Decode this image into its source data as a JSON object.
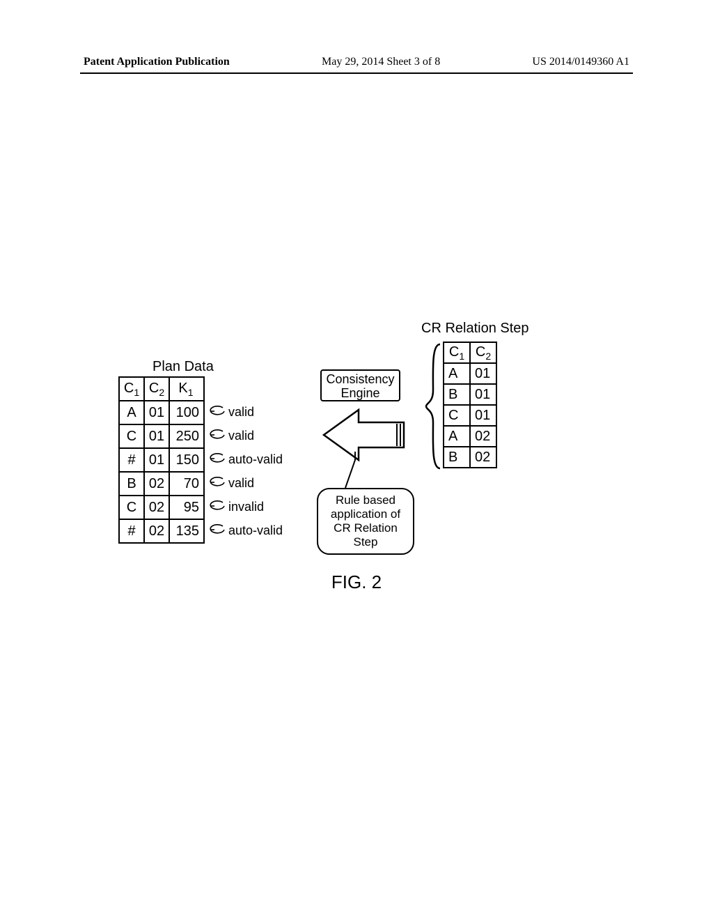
{
  "header": {
    "left": "Patent Application Publication",
    "center": "May 29, 2014  Sheet 3 of 8",
    "right": "US 2014/0149360 A1"
  },
  "plan": {
    "title": "Plan Data",
    "headers": {
      "c1": "C",
      "c1sub": "1",
      "c2": "C",
      "c2sub": "2",
      "k1": "K",
      "k1sub": "1"
    },
    "rows": [
      {
        "c1": "A",
        "c2": "01",
        "k1": "100",
        "status": "valid"
      },
      {
        "c1": "C",
        "c2": "01",
        "k1": "250",
        "status": "valid"
      },
      {
        "c1": "#",
        "c2": "01",
        "k1": "150",
        "status": "auto-valid"
      },
      {
        "c1": "B",
        "c2": "02",
        "k1": "70",
        "status": "valid"
      },
      {
        "c1": "C",
        "c2": "02",
        "k1": "95",
        "status": "invalid"
      },
      {
        "c1": "#",
        "c2": "02",
        "k1": "135",
        "status": "auto-valid"
      }
    ]
  },
  "cr": {
    "title": "CR Relation Step",
    "headers": {
      "c1": "C",
      "c1sub": "1",
      "c2": "C",
      "c2sub": "2"
    },
    "rows": [
      {
        "c1": "A",
        "c2": "01"
      },
      {
        "c1": "B",
        "c2": "01"
      },
      {
        "c1": "C",
        "c2": "01"
      },
      {
        "c1": "A",
        "c2": "02"
      },
      {
        "c1": "B",
        "c2": "02"
      }
    ]
  },
  "ce": {
    "label1": "Consistency",
    "label2": "Engine"
  },
  "rule": {
    "l1": "Rule based",
    "l2": "application of",
    "l3": "CR Relation",
    "l4": "Step"
  },
  "fig": "FIG. 2"
}
